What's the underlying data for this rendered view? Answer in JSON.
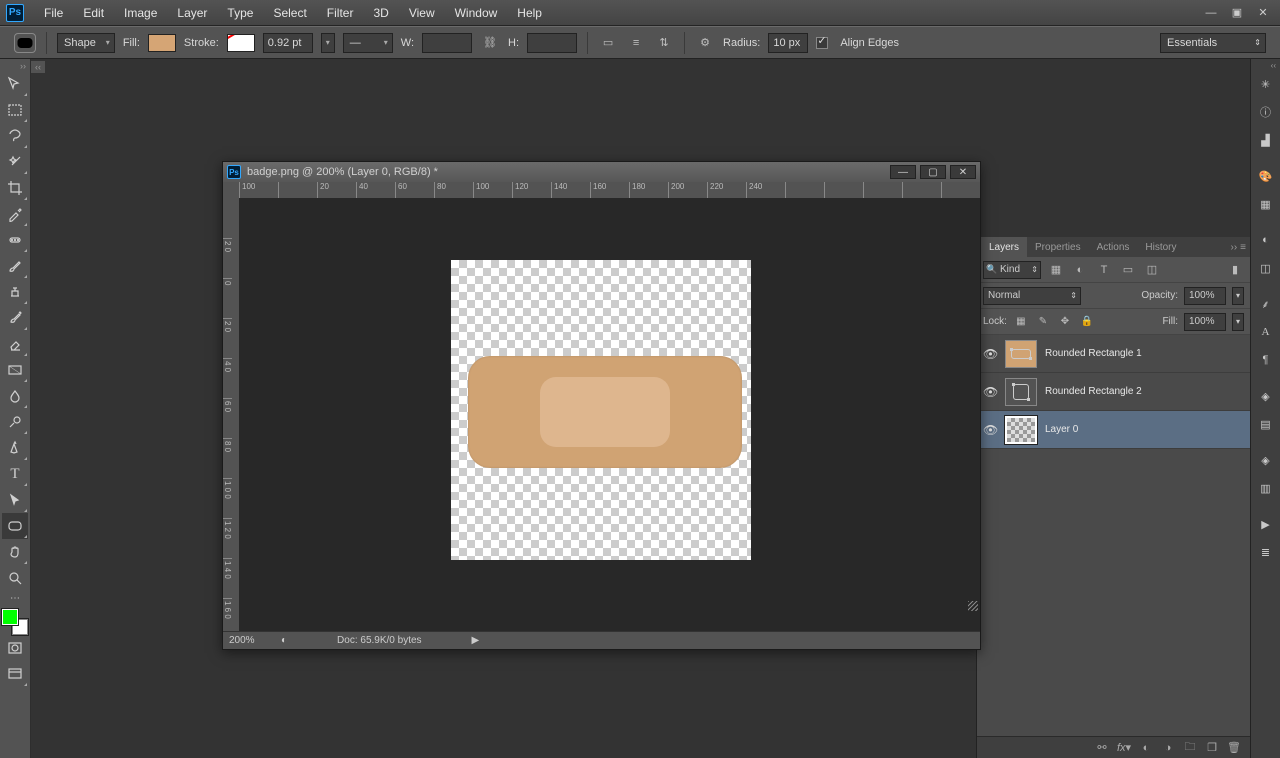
{
  "app": "Ps",
  "menus": [
    "File",
    "Edit",
    "Image",
    "Layer",
    "Type",
    "Select",
    "Filter",
    "3D",
    "View",
    "Window",
    "Help"
  ],
  "options": {
    "mode": "Shape",
    "fill_label": "Fill:",
    "stroke_label": "Stroke:",
    "stroke_w": "0.92 pt",
    "w_label": "W:",
    "h_label": "H:",
    "radius_label": "Radius:",
    "radius": "10 px",
    "align_edges": "Align Edges"
  },
  "workspace_preset": "Essentials",
  "doc": {
    "title": "badge.png @ 200% (Layer 0, RGB/8) *",
    "zoom": "200%",
    "status": "Doc: 65.9K/0 bytes",
    "ruler_h": [
      "100",
      "",
      "20",
      "40",
      "60",
      "80",
      "100",
      "120",
      "140",
      "160",
      "180",
      "200",
      "220",
      "240"
    ],
    "ruler_v": [
      "",
      "2 0",
      "0",
      "2 0",
      "4 0",
      "6 0",
      "8 0",
      "1 0 0",
      "1 2 0",
      "1 4 0",
      "1 6 0"
    ]
  },
  "layers_panel": {
    "tabs": [
      "Layers",
      "Properties",
      "Actions",
      "History"
    ],
    "filter_kind": "Kind",
    "blend": "Normal",
    "opacity_label": "Opacity:",
    "opacity": "100%",
    "fill_label": "Fill:",
    "fill": "100%",
    "lock_label": "Lock:",
    "layers": [
      {
        "name": "Rounded Rectangle 1",
        "thumb": "shape"
      },
      {
        "name": "Rounded Rectangle 2",
        "thumb": "shape2"
      },
      {
        "name": "Layer 0",
        "thumb": "trans",
        "selected": true
      }
    ]
  }
}
